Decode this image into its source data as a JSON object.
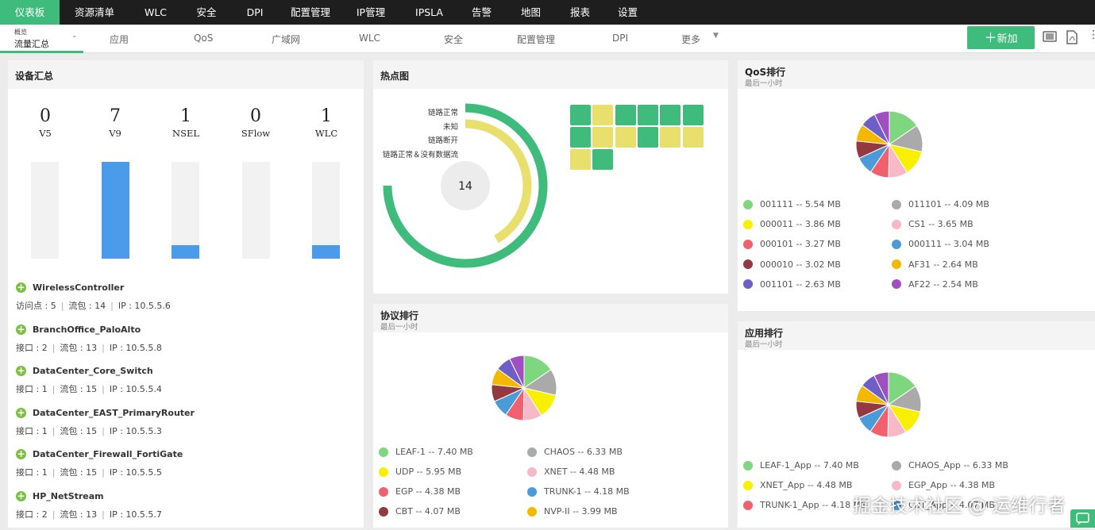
{
  "top_nav": [
    "仪表板",
    "资源清单",
    "WLC",
    "安全",
    "DPI",
    "配置管理",
    "IP管理",
    "IPSLA",
    "告警",
    "地图",
    "报表",
    "设置"
  ],
  "sub_nav": {
    "overview_small": "概览",
    "overview_label": "流量汇总",
    "items": [
      "应用",
      "QoS",
      "广域网",
      "WLC",
      "安全",
      "配置管理",
      "DPI",
      "更多"
    ]
  },
  "add_button": "新加",
  "device_summary": {
    "title": "设备汇总",
    "counts": [
      {
        "value": "0",
        "label": "V5",
        "level": 0
      },
      {
        "value": "7",
        "label": "V9",
        "level": 1.0
      },
      {
        "value": "1",
        "label": "NSEL",
        "level": 0.14
      },
      {
        "value": "0",
        "label": "SFlow",
        "level": 0
      },
      {
        "value": "1",
        "label": "WLC",
        "level": 0.14
      }
    ],
    "devices": [
      {
        "name": "WirelessController",
        "d1": "访问点 : 5",
        "d2": "流包 : 14",
        "d3": "IP : 10.5.5.6"
      },
      {
        "name": "BranchOffice_PaloAlto",
        "d1": "接口 : 2",
        "d2": "流包 : 13",
        "d3": "IP : 10.5.5.8"
      },
      {
        "name": "DataCenter_Core_Switch",
        "d1": "接口 : 1",
        "d2": "流包 : 15",
        "d3": "IP : 10.5.5.4"
      },
      {
        "name": "DataCenter_EAST_PrimaryRouter",
        "d1": "接口 : 1",
        "d2": "流包 : 15",
        "d3": "IP : 10.5.5.3"
      },
      {
        "name": "DataCenter_Firewall_FortiGate",
        "d1": "接口 : 1",
        "d2": "流包 : 15",
        "d3": "IP : 10.5.5.5"
      },
      {
        "name": "HP_NetStream",
        "d1": "接口 : 2",
        "d2": "流包 : 13",
        "d3": "IP : 10.5.5.7"
      }
    ]
  },
  "heatmap": {
    "title": "热点图",
    "center": "14",
    "labels": [
      "链路正常",
      "未知",
      "链路断开",
      "链路正常＆没有数据流"
    ],
    "colors": {
      "green": "#3fbb7c",
      "yellow": "#e8df6c"
    },
    "cells": [
      "green",
      "yellow",
      "green",
      "green",
      "green",
      "green",
      "green",
      "yellow",
      "yellow",
      "green",
      "yellow",
      "yellow",
      "yellow",
      "green"
    ]
  },
  "qos": {
    "title": "QoS排行",
    "subtitle": "最后一小时",
    "items": [
      {
        "label": "001111 -- 5.54 MB",
        "color": "#7ed67e"
      },
      {
        "label": "011101 -- 4.09 MB",
        "color": "#aaaaaa"
      },
      {
        "label": "000011 -- 3.86 MB",
        "color": "#f8f000"
      },
      {
        "label": "CS1 -- 3.65 MB",
        "color": "#f7b8c8"
      },
      {
        "label": "000101 -- 3.27 MB",
        "color": "#f0606e"
      },
      {
        "label": "000111 -- 3.04 MB",
        "color": "#4a9bd8"
      },
      {
        "label": "000010 -- 3.02 MB",
        "color": "#93393f"
      },
      {
        "label": "AF31 -- 2.64 MB",
        "color": "#f5b800"
      },
      {
        "label": "001101 -- 2.63 MB",
        "color": "#6e5fc8"
      },
      {
        "label": "AF22 -- 2.54 MB",
        "color": "#a04fc0"
      }
    ]
  },
  "protocol": {
    "title": "协议排行",
    "subtitle": "最后一小时",
    "items": [
      {
        "label": "LEAF-1 -- 7.40 MB",
        "color": "#7ed67e"
      },
      {
        "label": "CHAOS -- 6.33 MB",
        "color": "#aaaaaa"
      },
      {
        "label": "UDP -- 5.95 MB",
        "color": "#f8f000"
      },
      {
        "label": "XNET -- 4.48 MB",
        "color": "#f7b8c8"
      },
      {
        "label": "EGP -- 4.38 MB",
        "color": "#f0606e"
      },
      {
        "label": "TRUNK-1 -- 4.18 MB",
        "color": "#4a9bd8"
      },
      {
        "label": "CBT -- 4.07 MB",
        "color": "#93393f"
      },
      {
        "label": "NVP-II -- 3.99 MB",
        "color": "#f5b800"
      }
    ]
  },
  "app": {
    "title": "应用排行",
    "subtitle": "最后一小时",
    "items": [
      {
        "label": "LEAF-1_App -- 7.40 MB",
        "color": "#7ed67e"
      },
      {
        "label": "CHAOS_App -- 6.33 MB",
        "color": "#aaaaaa"
      },
      {
        "label": "XNET_App -- 4.48 MB",
        "color": "#f8f000"
      },
      {
        "label": "EGP_App -- 4.38 MB",
        "color": "#f7b8c8"
      },
      {
        "label": "TRUNK-1_App -- 4.18 MB",
        "color": "#f0606e"
      },
      {
        "label": "CBT_App -- 4.07 MB",
        "color": "#4a9bd8"
      }
    ]
  },
  "pie_values": [
    7.4,
    6.33,
    5.95,
    4.48,
    4.38,
    4.18,
    4.07,
    3.99,
    3.7,
    3.5
  ],
  "pie_colors": [
    "#7ed67e",
    "#aaaaaa",
    "#f8f000",
    "#f7b8c8",
    "#f0606e",
    "#4a9bd8",
    "#93393f",
    "#f5b800",
    "#6e5fc8",
    "#a04fc0"
  ],
  "watermark": "掘金技术社区 @ 运维行者"
}
